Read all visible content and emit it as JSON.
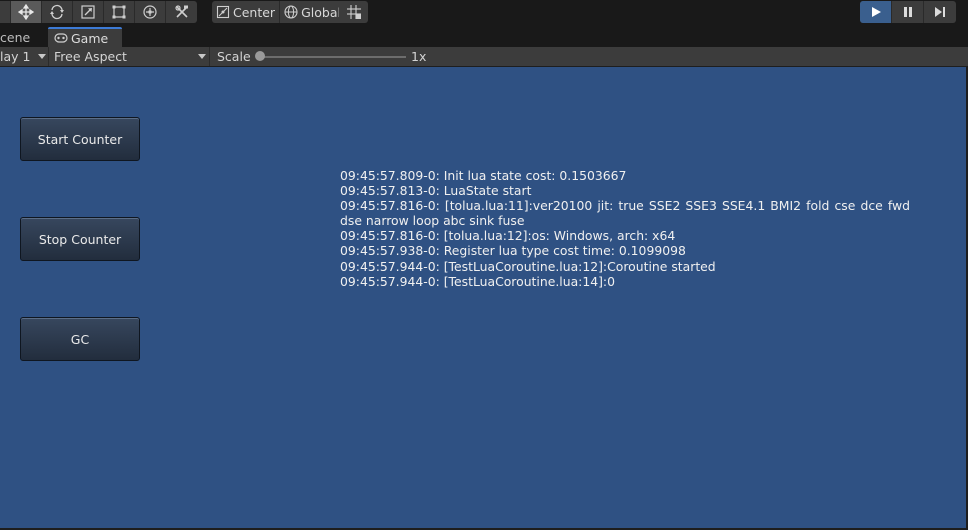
{
  "toolbar": {
    "tools": [
      {
        "name": "hand-tool-icon"
      },
      {
        "name": "move-tool-icon",
        "active": true
      },
      {
        "name": "rotate-tool-icon"
      },
      {
        "name": "scale-tool-icon"
      },
      {
        "name": "rect-tool-icon"
      },
      {
        "name": "transform-tool-icon"
      },
      {
        "name": "custom-tool-icon"
      }
    ],
    "pivot_label": "Center",
    "space_label": "Global"
  },
  "tabs": {
    "scene_label": "cene",
    "game_label": "Game"
  },
  "gamebar": {
    "display_label": "lay 1",
    "aspect_label": "Free Aspect",
    "scale_label": "Scale",
    "scale_value": "1x",
    "scale_fraction": 0
  },
  "buttons": {
    "start_label": "Start Counter",
    "stop_label": "Stop Counter",
    "gc_label": "GC"
  },
  "log": [
    "09:45:57.809-0: Init lua state cost: 0.1503667",
    "09:45:57.813-0: LuaState start",
    "09:45:57.816-0: [tolua.lua:11]:ver20100 jit:    true    SSE2    SSE3    SSE4.1    BMI2    fold    cse    dce    fwd    dse    narrow    loop    abc    sink    fuse",
    "09:45:57.816-0: [tolua.lua:12]:os: Windows, arch: x64",
    "09:45:57.938-0: Register lua type cost time: 0.1099098",
    "09:45:57.944-0: [TestLuaCoroutine.lua:12]:Coroutine started",
    "09:45:57.944-0: [TestLuaCoroutine.lua:14]:0"
  ],
  "colors": {
    "game_background": "#2f5183",
    "accent": "#3d7bd6",
    "play_active": "#3a5f8e"
  }
}
